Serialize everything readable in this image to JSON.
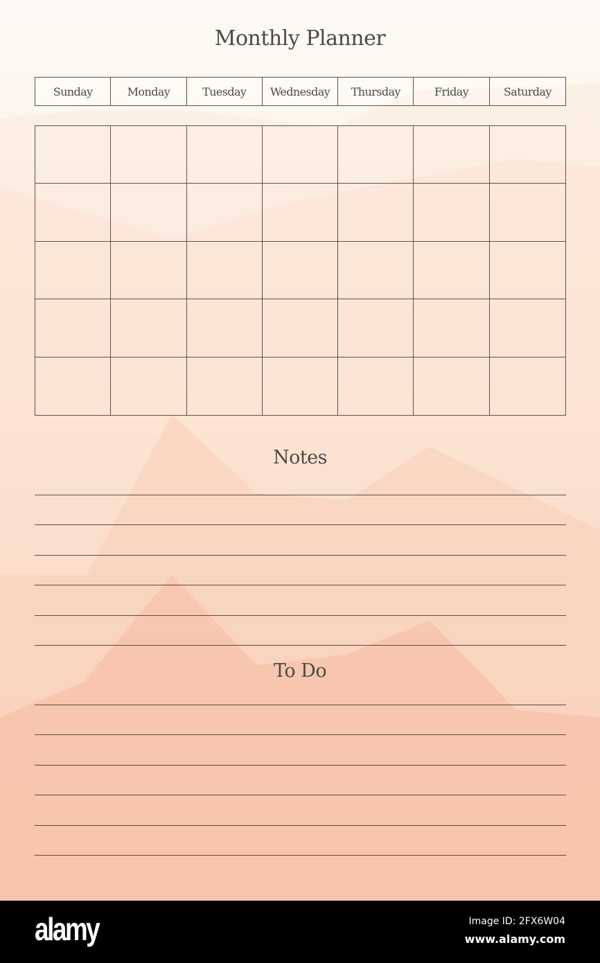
{
  "planner": {
    "title": "Monthly Planner",
    "weekdays": [
      "Sunday",
      "Monday",
      "Tuesday",
      "Wednesday",
      "Thursday",
      "Friday",
      "Saturday"
    ],
    "calendar_rows": 5,
    "notes": {
      "title": "Notes",
      "line_count": 6
    },
    "todo": {
      "title": "To Do",
      "line_count": 6
    }
  },
  "colors": {
    "background_top": "#fdfbf6",
    "background_bottom": "#f9bda6",
    "line": "#5a4a45",
    "text": "#4a4a4a"
  },
  "footer": {
    "brand": "alamy",
    "image_id": "Image ID: 2FX6W04",
    "site": "www.alamy.com"
  }
}
